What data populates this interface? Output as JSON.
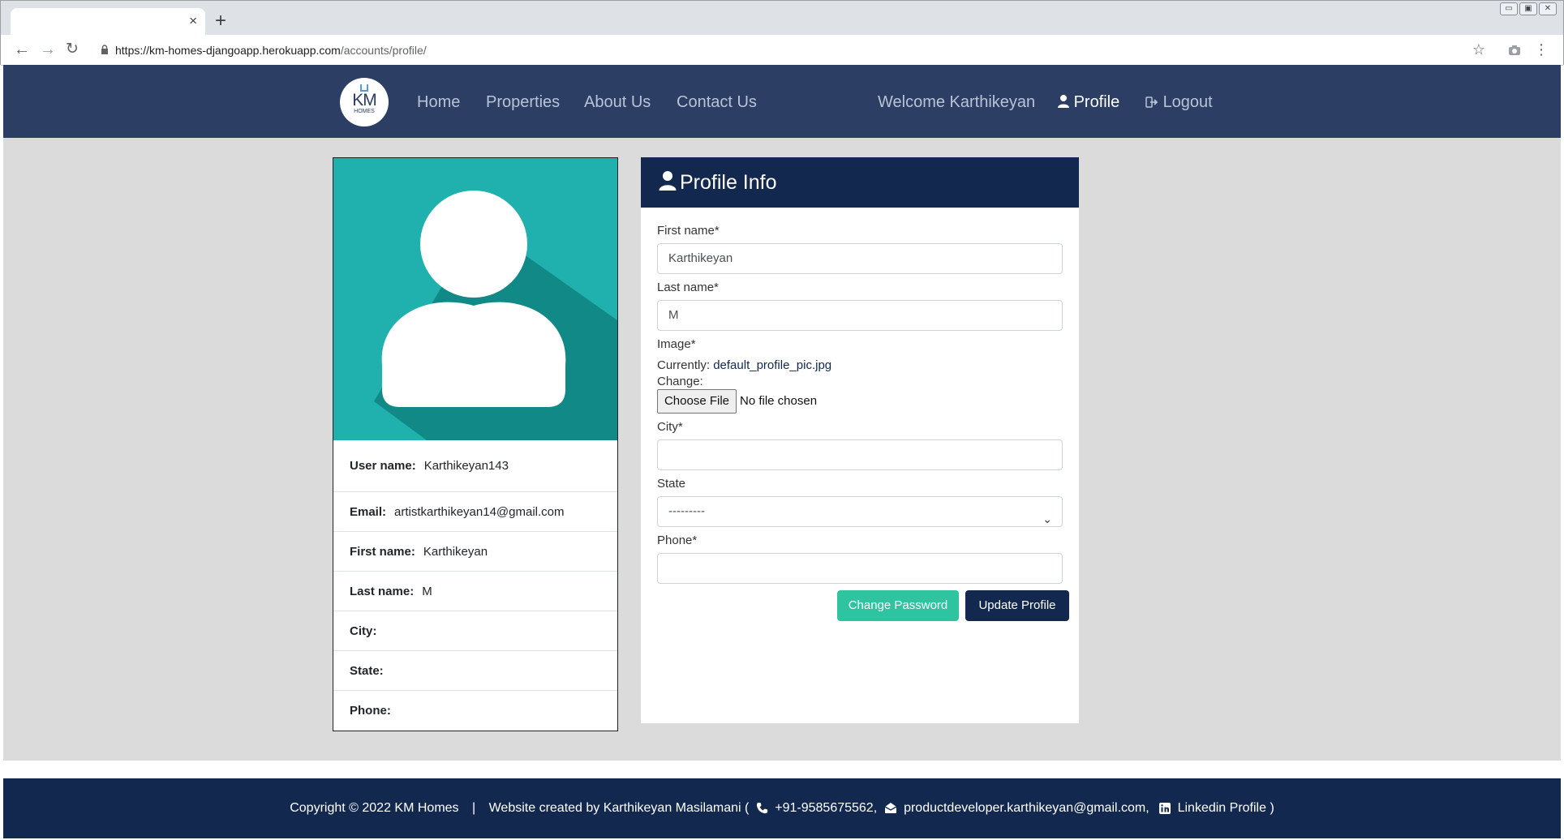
{
  "browser": {
    "tab_close": "×",
    "new_tab": "+",
    "url_host": "https://km-homes-djangoapp.herokuapp.com",
    "url_path": "/accounts/profile/",
    "win_controls": [
      "▭",
      "▣",
      "✕"
    ]
  },
  "nav": {
    "logo_text": "KM",
    "logo_sub": "HOMES",
    "links": [
      "Home",
      "Properties",
      "About Us",
      "Contact Us"
    ],
    "welcome": "Welcome Karthikeyan",
    "profile": "Profile",
    "logout": "Logout"
  },
  "profile_card": {
    "rows": [
      {
        "label": "User name:",
        "value": "Karthikeyan143"
      },
      {
        "label": "Email:",
        "value": "artistkarthikeyan14@gmail.com"
      },
      {
        "label": "First name:",
        "value": "Karthikeyan"
      },
      {
        "label": "Last name:",
        "value": "M"
      },
      {
        "label": "City:",
        "value": ""
      },
      {
        "label": "State:",
        "value": ""
      },
      {
        "label": "Phone:",
        "value": ""
      }
    ]
  },
  "form": {
    "title": "Profile Info",
    "first_name_label": "First name*",
    "first_name_value": "Karthikeyan",
    "last_name_label": "Last name*",
    "last_name_value": "M",
    "image_label": "Image*",
    "currently_label": "Currently:",
    "currently_value": "default_profile_pic.jpg",
    "change_label": "Change:",
    "choose_file": "Choose File",
    "no_file": "No file chosen",
    "city_label": "City*",
    "city_value": "",
    "state_label": "State",
    "state_value": "---------",
    "phone_label": "Phone*",
    "phone_value": "",
    "change_password": "Change Password",
    "update_profile": "Update Profile"
  },
  "footer": {
    "copyright": "Copyright © 2022 KM Homes",
    "separator": "|",
    "created_by": "Website created by Karthikeyan Masilamani (",
    "phone": "+91-9585675562,",
    "email": "productdeveloper.karthikeyan@gmail.com,",
    "linkedin": "Linkedin Profile",
    "close": ")"
  },
  "colors": {
    "nav_bg": "#2c3e64",
    "dark_blue": "#13284e",
    "teal": "#2fc4a0",
    "avatar_bg": "#20b1ae"
  }
}
